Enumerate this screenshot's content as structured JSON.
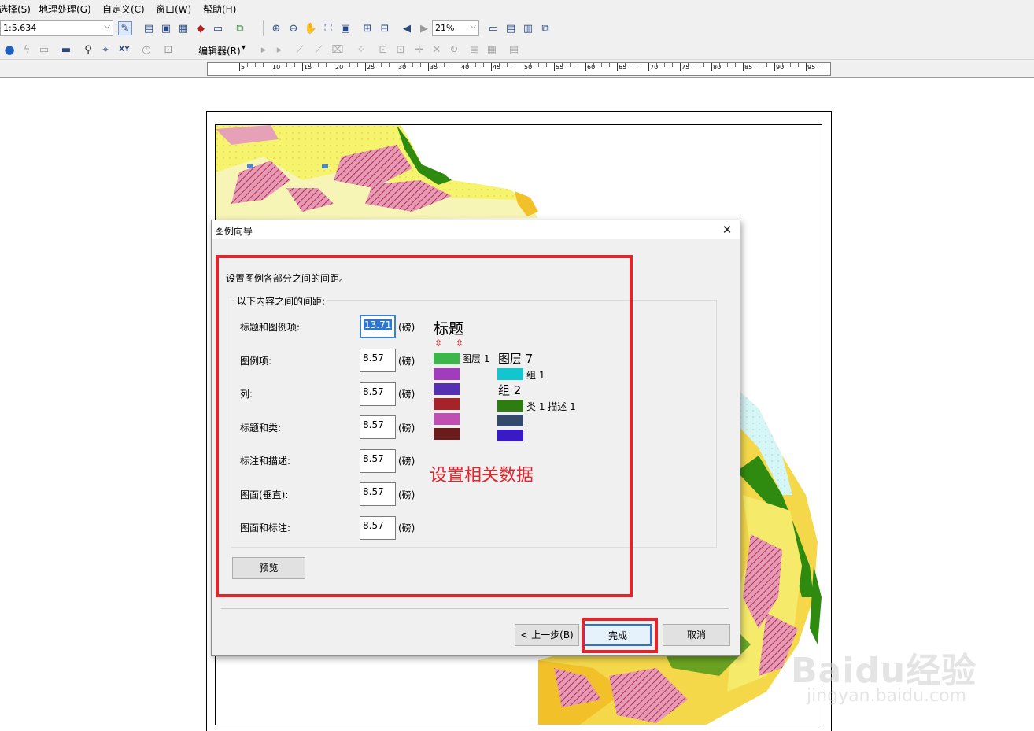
{
  "menubar": {
    "items": [
      "选择(S)",
      "地理处理(G)",
      "自定义(C)",
      "窗口(W)",
      "帮助(H)"
    ]
  },
  "toolbar": {
    "scale_value": "1:5,634",
    "zoom_value": "21%",
    "editor_label": "编辑器(R)"
  },
  "ruler": {
    "labels": [
      "5",
      "10",
      "15",
      "20",
      "25",
      "30",
      "35",
      "40",
      "45",
      "50",
      "55",
      "60",
      "65",
      "70",
      "75",
      "80",
      "85",
      "90",
      "95"
    ]
  },
  "dialog": {
    "title": "图例向导",
    "instruction": "设置图例各部分之间的间距。",
    "group_label": "以下内容之间的间距:",
    "unit": "(磅)",
    "fields": [
      {
        "label": "标题和图例项:",
        "value": "13.71"
      },
      {
        "label": "图例项:",
        "value": "8.57"
      },
      {
        "label": "列:",
        "value": "8.57"
      },
      {
        "label": "标题和类:",
        "value": "8.57"
      },
      {
        "label": "标注和描述:",
        "value": "8.57"
      },
      {
        "label": "图面(垂直):",
        "value": "8.57"
      },
      {
        "label": "图面和标注:",
        "value": "8.57"
      }
    ],
    "preview": {
      "title": "标题",
      "layer1_label": "图层 1",
      "layer7_heading": "图层 7",
      "group1_label": "组 1",
      "group2_heading": "组 2",
      "class_label": "类 1 描述 1",
      "colors_col1": [
        "#3cb54a",
        "#a33bbf",
        "#5530b3",
        "#a8222a",
        "#c04fb3",
        "#6b1b1c"
      ],
      "colors_col2": [
        "#12c6cf",
        "#2f7c13",
        "#334a6d",
        "#3a1ac7"
      ]
    },
    "annotation": "设置相关数据",
    "buttons": {
      "preview": "预览",
      "back": "< 上一步(B)",
      "finish": "完成",
      "cancel": "取消"
    }
  },
  "watermark": {
    "brand": "Baidu经验",
    "url": "jingyan.baidu.com"
  }
}
